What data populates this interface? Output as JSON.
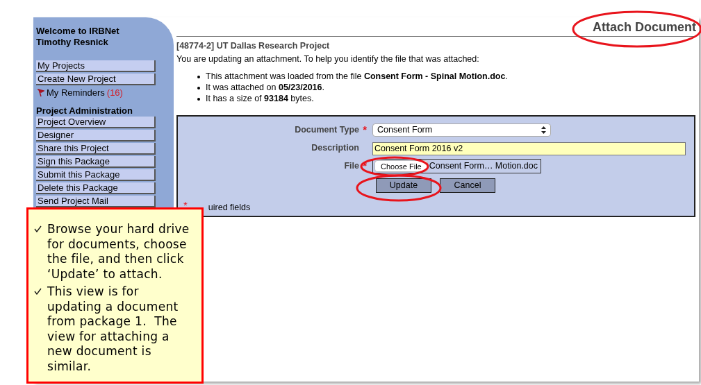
{
  "sidebar": {
    "welcome": "Welcome to IRBNet",
    "user": "Timothy Resnick",
    "items": [
      {
        "label": "My Projects",
        "kind": "link"
      },
      {
        "label": "Create New Project",
        "kind": "link"
      },
      {
        "label": "My Reminders",
        "count": "(16)",
        "kind": "reminder"
      }
    ],
    "section": {
      "title": "Project Administration",
      "items": [
        "Project Overview",
        "Designer",
        "Share this Project",
        "Sign this Package",
        "Submit this Package",
        "Delete this Package",
        "Send Project Mail"
      ]
    }
  },
  "page_title": "Attach Document",
  "project": "[48774-2] UT Dallas Research Project",
  "intro": "You are updating an attachment. To help you identify the file that was attached:",
  "facts": [
    "This attachment was loaded from the file **Consent Form - Spinal Motion.doc**.",
    "It was attached on **05/23/2016**.",
    "It has a size of **93184** bytes."
  ],
  "form": {
    "required_mark": "*",
    "fields": [
      {
        "label": "Document Type",
        "required": true,
        "kind": "select",
        "value": "Consent Form"
      },
      {
        "label": "Description",
        "required": false,
        "kind": "text",
        "value": "Consent Form 2016 v2"
      },
      {
        "label": "File",
        "required": true,
        "kind": "file",
        "button": "Choose File",
        "value": "Consent Form… Motion.doc"
      }
    ],
    "buttons": [
      "Update",
      "Cancel"
    ],
    "required_note": "uired fields"
  },
  "callout": {
    "items": [
      "Browse your hard drive for documents, choose the file, and then click ‘Update’ to attach.",
      "This view is for updating a document from package 1.  The view for attaching a new document is similar."
    ]
  }
}
